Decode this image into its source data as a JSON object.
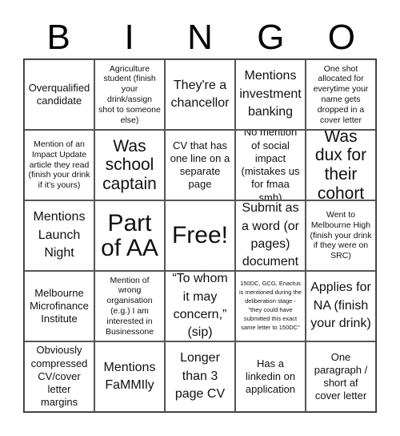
{
  "header": {
    "letters": [
      "B",
      "I",
      "N",
      "G",
      "O"
    ]
  },
  "cells": [
    [
      "Overqualified candidate",
      "Agriculture student (finish your drink/assign shot to someone else)",
      "They're a chancellor",
      "Mentions investment banking",
      "One shot allocated for everytime your name gets dropped in a cover letter"
    ],
    [
      "Mention of an Impact Update article they read (finish your drink if it's yours)",
      "Was school captain",
      "CV that has one line on a separate page",
      "No mention of social impact (mistakes us for fmaa smh)",
      "Was dux for their cohort"
    ],
    [
      "Mentions Launch Night",
      "Part of AA",
      "Free!",
      "Submit as a word (or pages) document",
      "Went to Melbourne High (finish your drink if they were on SRC)"
    ],
    [
      "Melbourne Microfinance Institute",
      "Mention of wrong organisation (e.g.) I am interested in Businessone",
      "“To whom it may concern,” (sip)",
      "150DC, GCG, Enactus is mentioned during the deliberation stage - \"they could have submitted this exact same letter to 150DC\"",
      "Applies for NA (finish your drink)"
    ],
    [
      "Obviously compressed CV/cover letter margins",
      "Mentions FaMMIly",
      "Longer than 3 page CV",
      "Has a linkedin on application",
      "One paragraph / short af cover letter"
    ]
  ]
}
